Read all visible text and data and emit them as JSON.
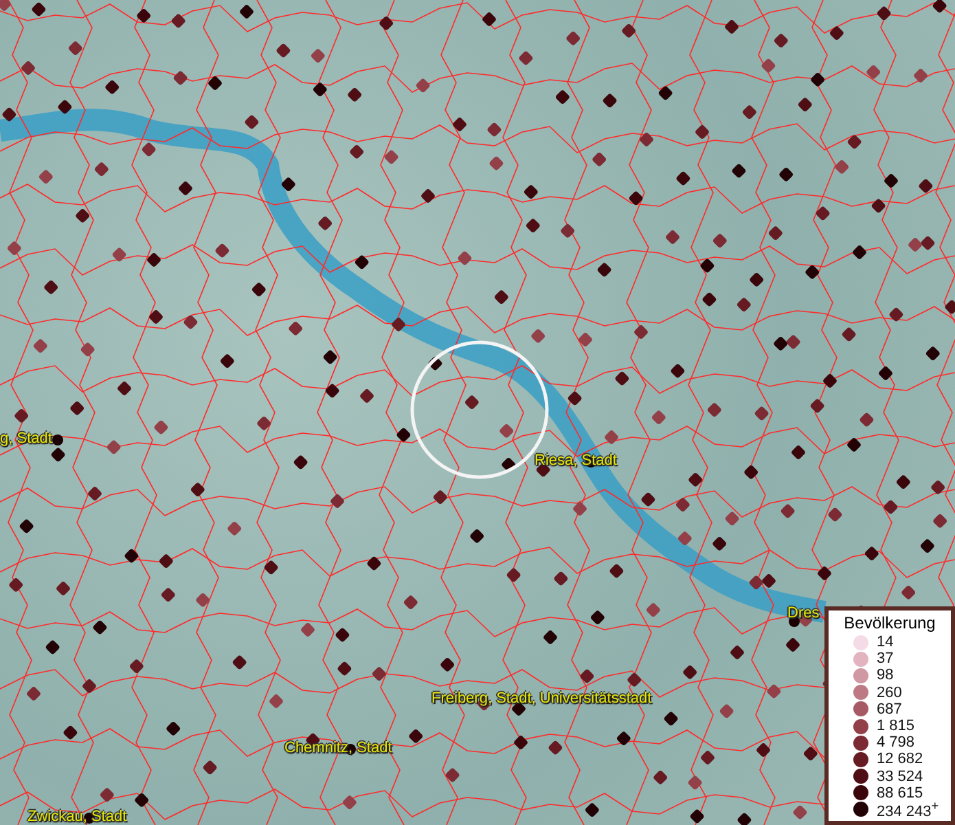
{
  "map_labels": [
    {
      "name": "g, Stadt"
    },
    {
      "name": "Riesa, Stadt"
    },
    {
      "name": "Freiberg, Stadt, Universitätsstadt"
    },
    {
      "name": "Chemnitz, Stadt"
    },
    {
      "name": "Zwickau, Stadt"
    },
    {
      "name": "Dres"
    }
  ],
  "legend": {
    "title": "Bevölkerung",
    "entries": [
      {
        "value": "14",
        "color": "#f5dbe6"
      },
      {
        "value": "37",
        "color": "#e2b4c0"
      },
      {
        "value": "98",
        "color": "#cf98a3"
      },
      {
        "value": "260",
        "color": "#bd7a85"
      },
      {
        "value": "687",
        "color": "#a85a64"
      },
      {
        "value": "1 815",
        "color": "#934049"
      },
      {
        "value": "4 798",
        "color": "#7c2a33"
      },
      {
        "value": "12 682",
        "color": "#661a22"
      },
      {
        "value": "33 524",
        "color": "#4f0d14"
      },
      {
        "value": "88 615",
        "color": "#3a060b"
      },
      {
        "value": "234 243$^{+}$",
        "color": "#220205"
      }
    ]
  }
}
